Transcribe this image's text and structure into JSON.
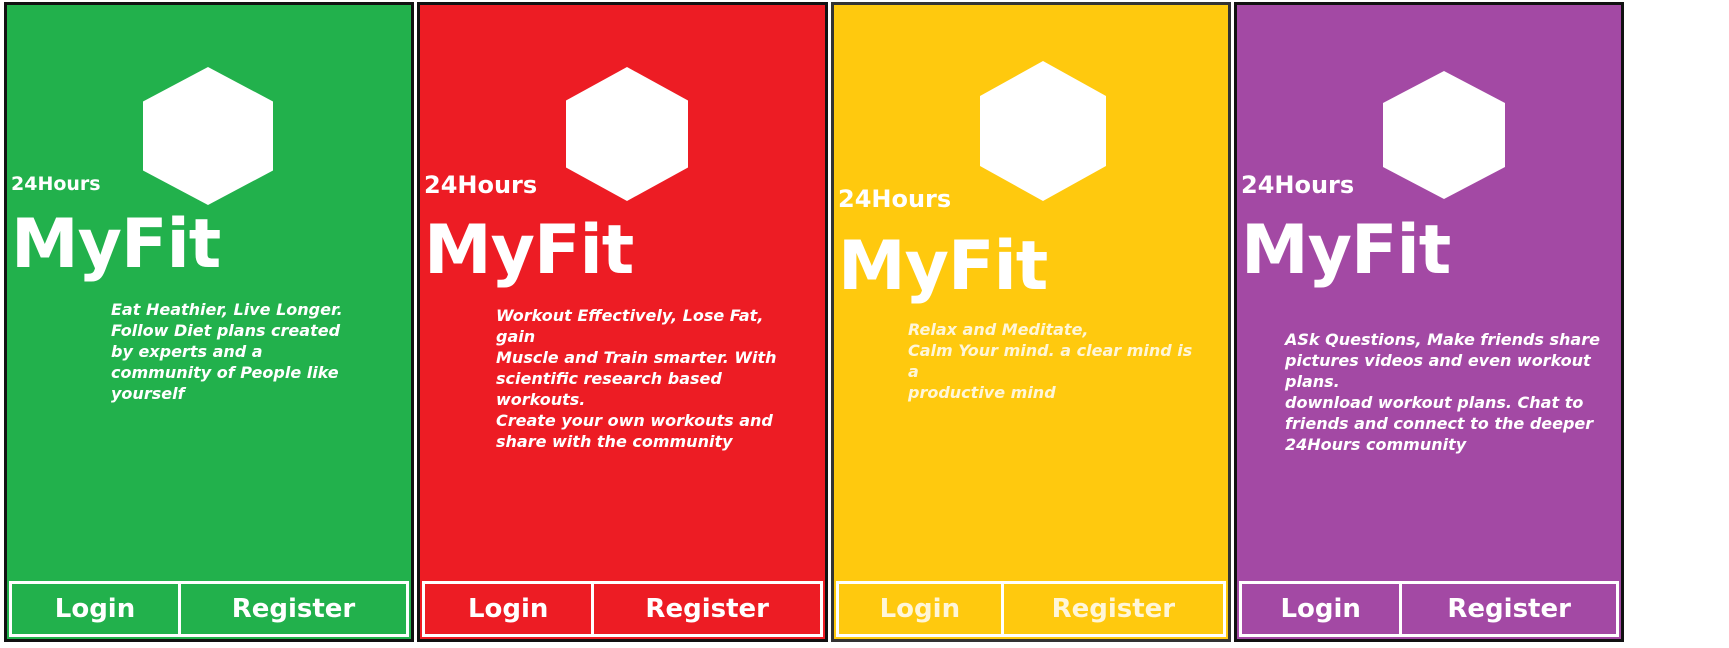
{
  "screens": [
    {
      "brand_small": "24Hours",
      "brand_big": "MyFit",
      "tagline": "Eat Heathier, Live Longer.\nFollow Diet plans created\nby experts and a\ncommunity of People like\nyourself",
      "login_label": "Login",
      "register_label": "Register",
      "color": "#22b14c"
    },
    {
      "brand_small": "24Hours",
      "brand_big": "MyFit",
      "tagline": "Workout Effectively, Lose Fat, gain\nMuscle and Train smarter. With\nscientific research based workouts.\nCreate your own workouts and\nshare with the community",
      "login_label": "Login",
      "register_label": "Register",
      "color": "#ed1c24"
    },
    {
      "brand_small": "24Hours",
      "brand_big": "MyFit",
      "tagline": "Relax and Meditate,\nCalm Your mind. a clear mind is a\nproductive mind",
      "login_label": "Login",
      "register_label": "Register",
      "color": "#ffc90e"
    },
    {
      "brand_small": "24Hours",
      "brand_big": "MyFit",
      "tagline": "ASk Questions, Make friends share\npictures videos and even workout plans.\ndownload workout plans. Chat to\nfriends and connect to the deeper\n24Hours community",
      "login_label": "Login",
      "register_label": "Register",
      "color": "#a349a4"
    }
  ],
  "icons": {
    "logo": "hexagon-logo-icon"
  }
}
